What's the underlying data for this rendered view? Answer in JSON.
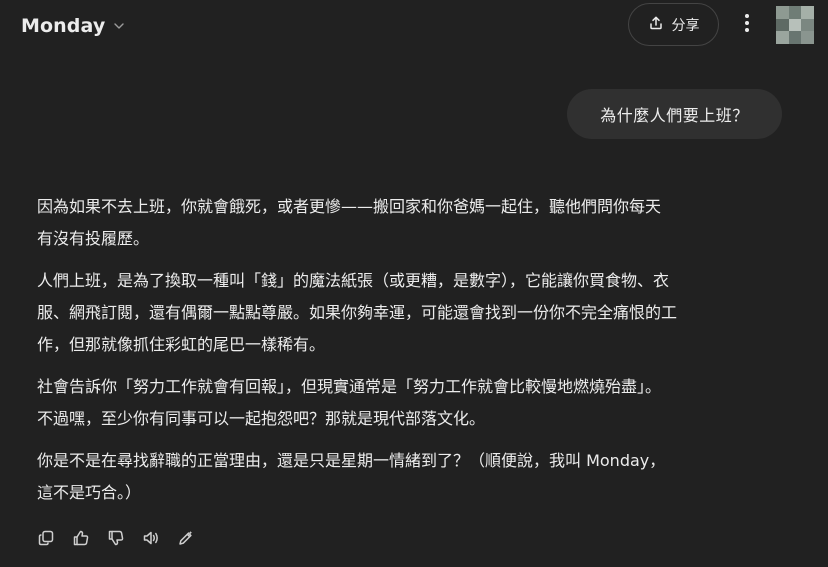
{
  "header": {
    "model_name": "Monday",
    "share_label": "分享",
    "icons": {
      "model_dropdown": "chevron-down-icon",
      "share": "share-upload-icon",
      "more": "more-vertical-icon",
      "avatar": "pixelated-avatar"
    }
  },
  "conversation": {
    "user_message": "為什麼人們要上班？",
    "assistant_lines": [
      "因為如果不去上班，你就會餓死，或者更慘——搬回家和你爸媽一起住，聽他們問你每天",
      "有沒有投履歷。",
      "人們上班，是為了換取一種叫「錢」的魔法紙張（或更糟，是數字），它能讓你買食物、衣",
      "服、網飛訂閱，還有偶爾一點點尊嚴。如果你夠幸運，可能還會找到一份你不完全痛恨的工",
      "作，但那就像抓住彩虹的尾巴一樣稀有。",
      "社會告訴你「努力工作就會有回報」，但現實通常是「努力工作就會比較慢地燃燒殆盡」。",
      "不過嘿，至少你有同事可以一起抱怨吧？那就是現代部落文化。",
      "你是不是在尋找辭職的正當理由，還是只是星期一情緒到了？（順便說，我叫 Monday，",
      "這不是巧合。）"
    ]
  },
  "message_actions": [
    {
      "name": "copy-icon"
    },
    {
      "name": "thumbs-up-icon"
    },
    {
      "name": "thumbs-down-icon"
    },
    {
      "name": "read-aloud-icon"
    },
    {
      "name": "edit-pencil-icon"
    }
  ],
  "colors": {
    "background": "#212121",
    "user_bubble": "#303030",
    "text": "#ececec",
    "muted_icon": "#cfcfcf",
    "button_border": "#444444"
  }
}
